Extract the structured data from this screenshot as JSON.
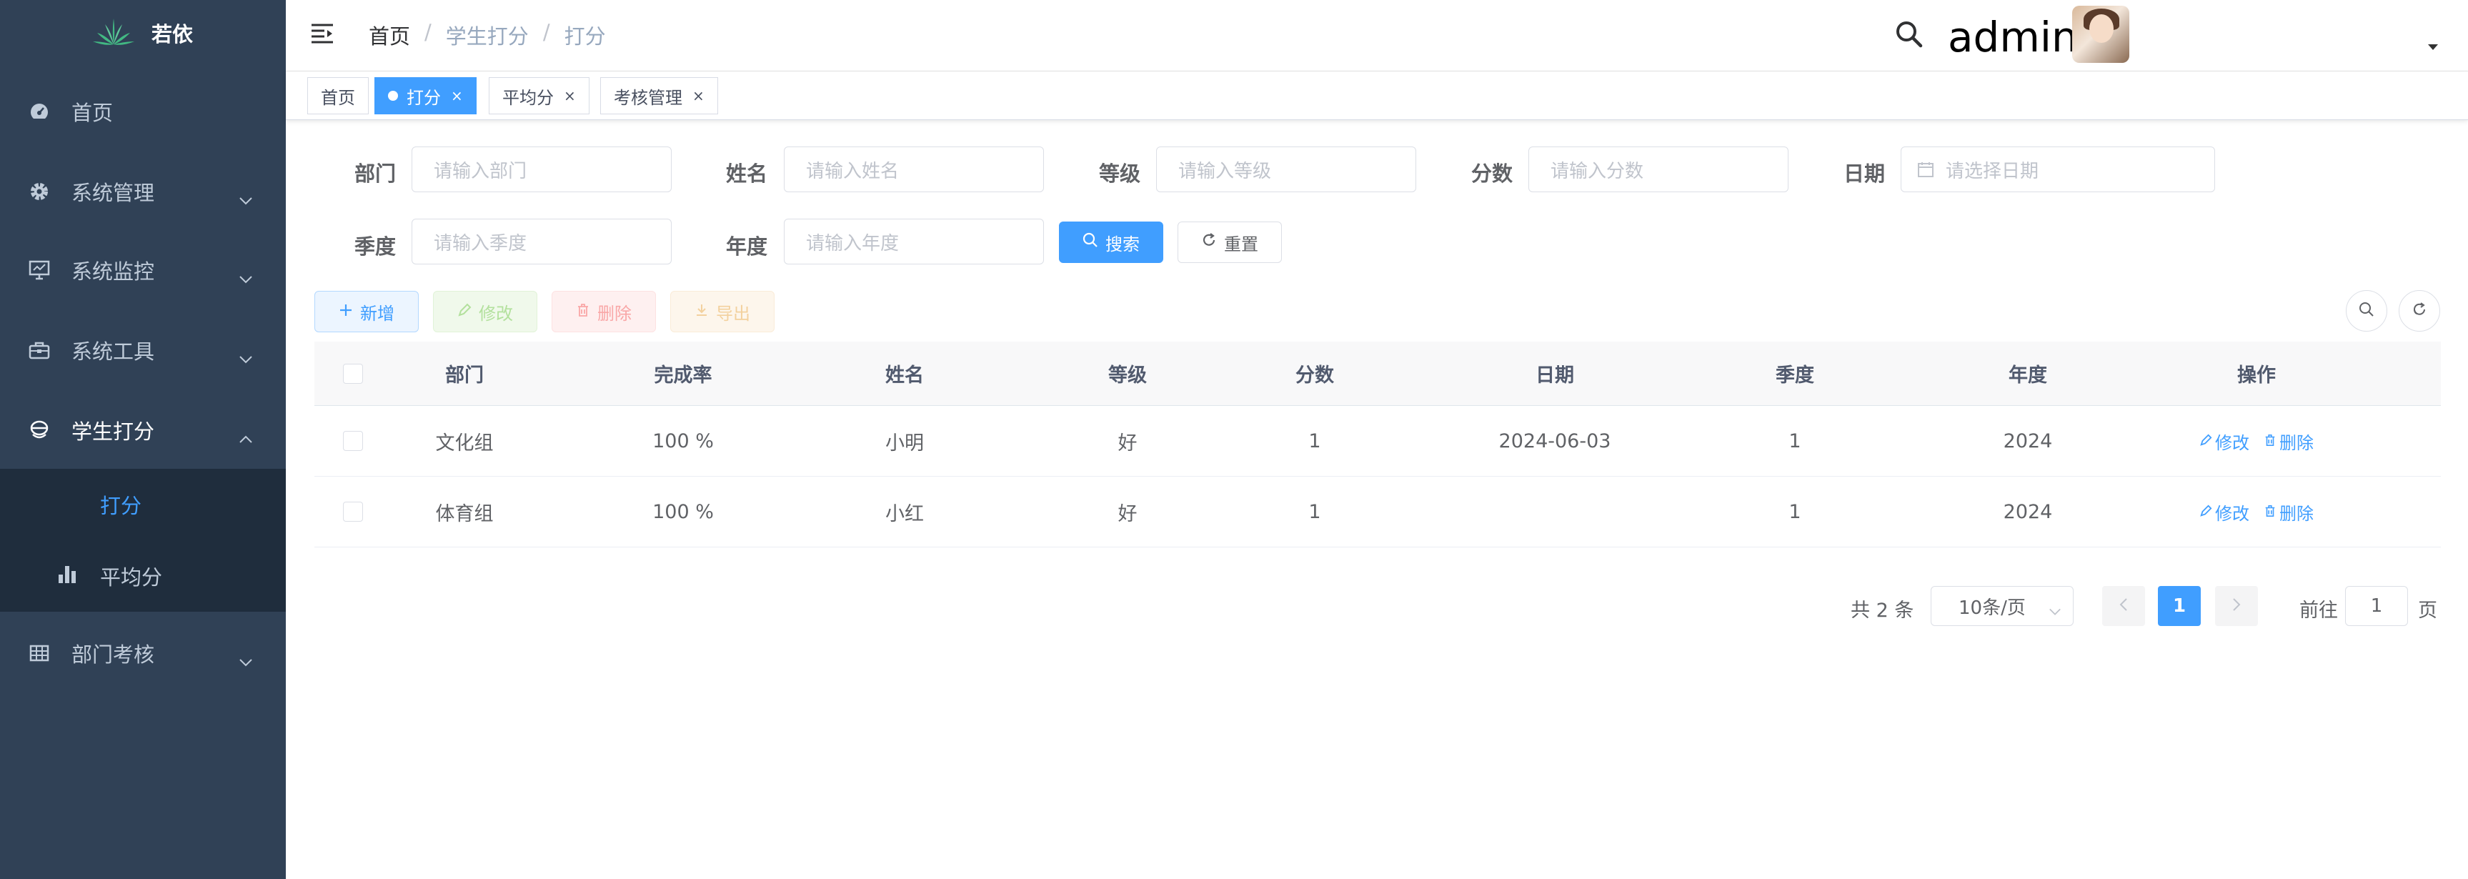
{
  "app": {
    "title": "若依"
  },
  "sidebar": {
    "items": [
      {
        "label": "首页",
        "icon": "dashboard-icon"
      },
      {
        "label": "系统管理",
        "icon": "gear-icon"
      },
      {
        "label": "系统监控",
        "icon": "monitor-icon"
      },
      {
        "label": "系统工具",
        "icon": "toolbox-icon"
      },
      {
        "label": "学生打分",
        "icon": "student-icon",
        "expanded": true
      },
      {
        "label": "部门考核",
        "icon": "table-icon"
      }
    ],
    "subitems": [
      {
        "label": "打分",
        "active": true
      },
      {
        "label": "平均分",
        "icon": "bar-chart-icon"
      }
    ]
  },
  "navbar": {
    "breadcrumb": [
      "首页",
      "学生打分",
      "打分"
    ],
    "breadcrumb_sep": "/",
    "username": "admin"
  },
  "tags": [
    {
      "label": "首页",
      "closable": false
    },
    {
      "label": "打分",
      "closable": true,
      "active": true
    },
    {
      "label": "平均分",
      "closable": true
    },
    {
      "label": "考核管理",
      "closable": true
    }
  ],
  "tag_close": "×",
  "form": {
    "dept": {
      "label": "部门",
      "placeholder": "请输入部门"
    },
    "name": {
      "label": "姓名",
      "placeholder": "请输入姓名"
    },
    "level": {
      "label": "等级",
      "placeholder": "请输入等级"
    },
    "score": {
      "label": "分数",
      "placeholder": "请输入分数"
    },
    "date": {
      "label": "日期",
      "placeholder": "请选择日期"
    },
    "season": {
      "label": "季度",
      "placeholder": "请输入季度"
    },
    "year": {
      "label": "年度",
      "placeholder": "请输入年度"
    },
    "search_label": "搜索",
    "reset_label": "重置"
  },
  "toolbar": {
    "add_label": "新增",
    "edit_label": "修改",
    "delete_label": "删除",
    "export_label": "导出"
  },
  "table": {
    "columns": [
      "部门",
      "完成率",
      "姓名",
      "等级",
      "分数",
      "日期",
      "季度",
      "年度",
      "操作"
    ],
    "rows": [
      {
        "dept": "文化组",
        "rate": "100 %",
        "name": "小明",
        "level": "好",
        "score": "1",
        "date": "2024-06-03",
        "season": "1",
        "year": "2024"
      },
      {
        "dept": "体育组",
        "rate": "100 %",
        "name": "小红",
        "level": "好",
        "score": "1",
        "date": "",
        "season": "1",
        "year": "2024"
      }
    ],
    "row_edit": "修改",
    "row_delete": "删除"
  },
  "pagination": {
    "total_text": "共 2 条",
    "page_size": "10条/页",
    "current_page": "1",
    "goto_label": "前往",
    "goto_value": "1",
    "goto_suffix": "页"
  },
  "colors": {
    "sidebar_bg": "#304156",
    "submenu_bg": "#1f2d3d",
    "primary": "#409eff"
  }
}
